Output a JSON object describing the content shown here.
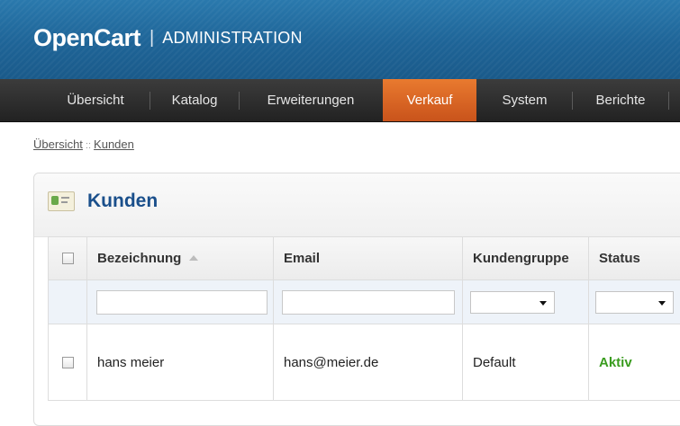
{
  "header": {
    "brand": "OpenCart",
    "separator": "|",
    "subtitle": "ADMINISTRATION"
  },
  "menu": {
    "items": [
      {
        "label": "Übersicht"
      },
      {
        "label": "Katalog"
      },
      {
        "label": "Erweiterungen"
      },
      {
        "label": "Verkauf",
        "active": true
      },
      {
        "label": "System"
      },
      {
        "label": "Berichte"
      }
    ]
  },
  "breadcrumb": {
    "items": [
      "Übersicht",
      "Kunden"
    ],
    "separator": "::"
  },
  "panel": {
    "title": "Kunden",
    "icon": "customer-card-icon"
  },
  "table": {
    "columns": [
      "Bezeichnung",
      "Email",
      "Kundengruppe",
      "Status"
    ],
    "sorted_column": "Bezeichnung",
    "sort_direction": "ascending",
    "filters": {
      "name": "",
      "email": "",
      "group": "",
      "status": ""
    },
    "rows": [
      {
        "name": "hans meier",
        "email": "hans@meier.de",
        "group": "Default",
        "status": "Aktiv"
      }
    ]
  },
  "colors": {
    "header_blue": "#1e6497",
    "menu_dark": "#2b2b2b",
    "menu_active": "#d9621f",
    "title_blue": "#1a4f8b",
    "status_active": "#3a9c1f"
  }
}
